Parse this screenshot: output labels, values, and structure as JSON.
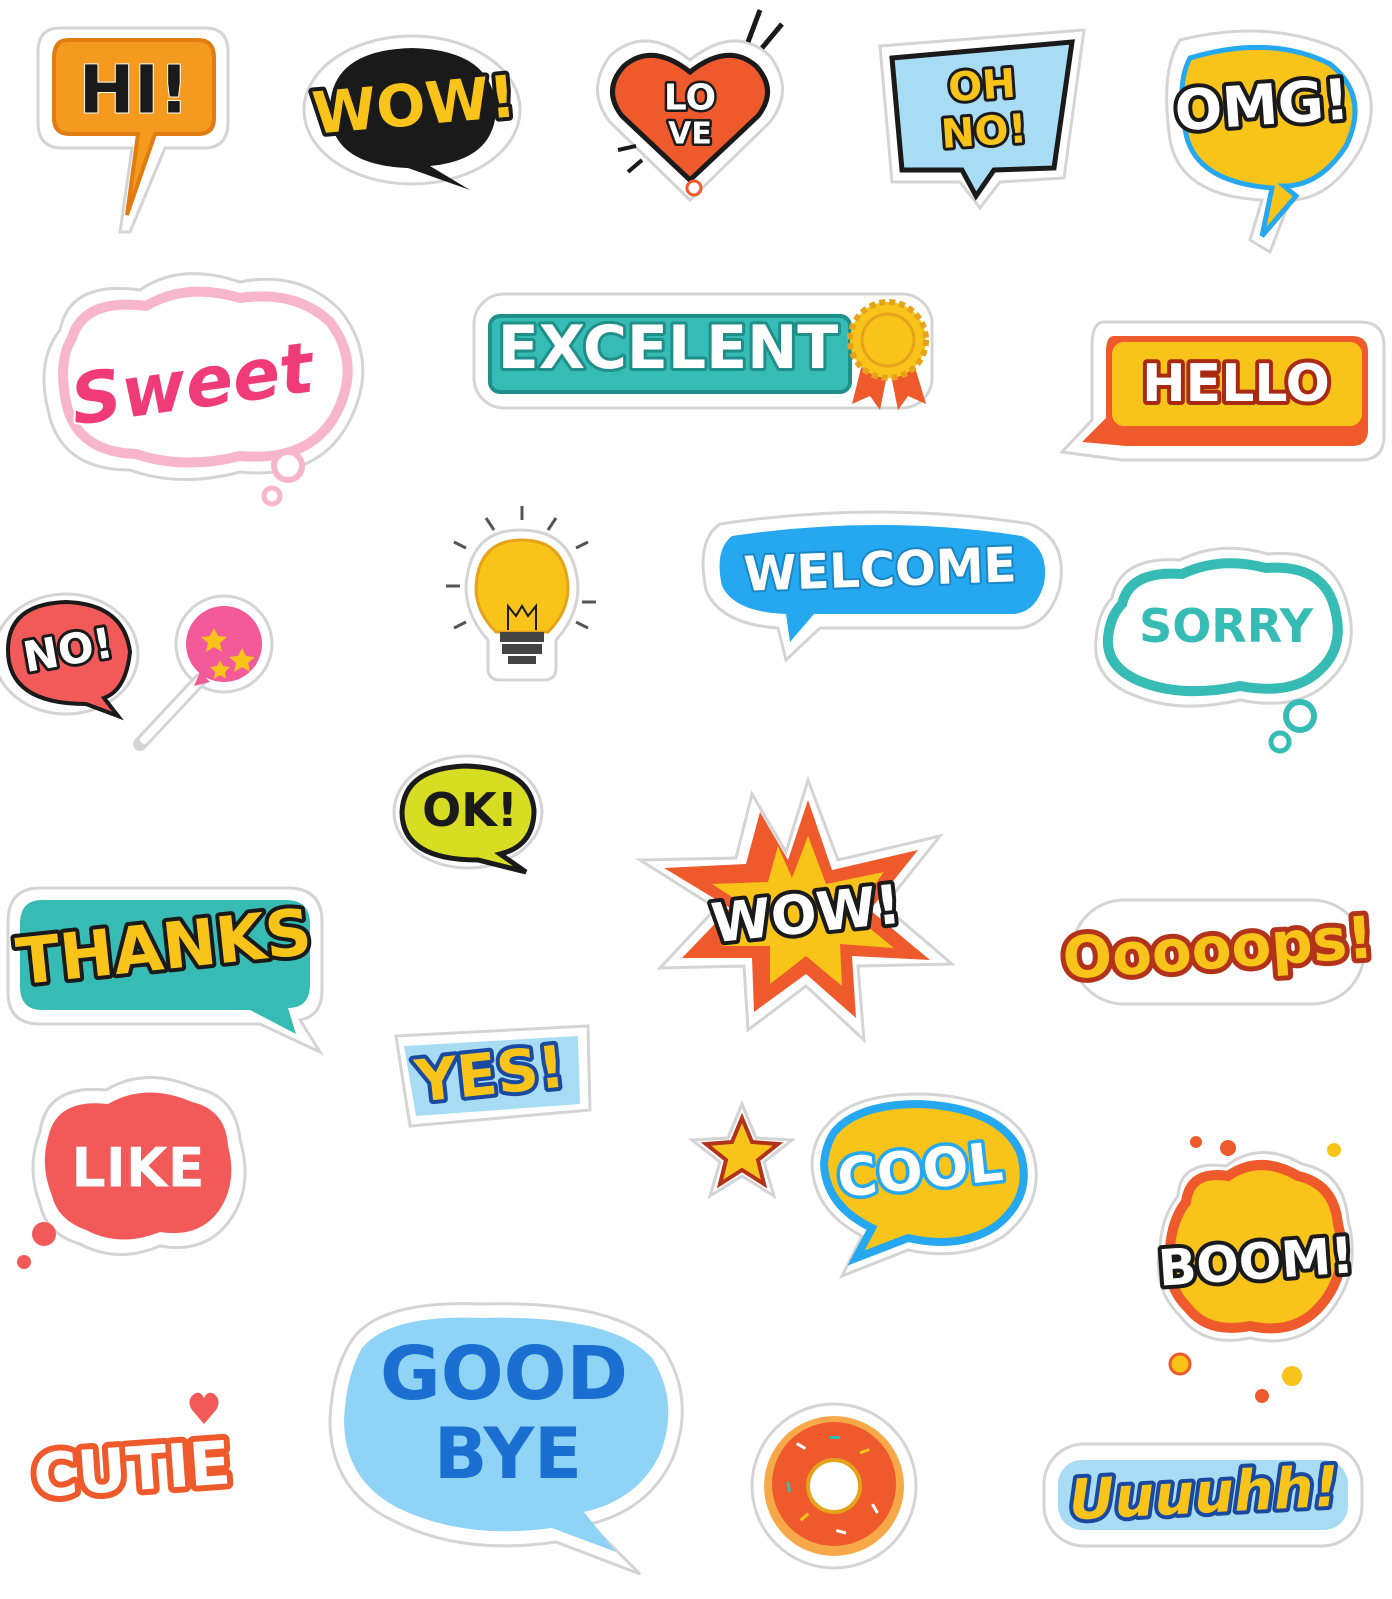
{
  "stickers": {
    "hi": "HI!",
    "wow_top": "WOW!",
    "love_1": "LO",
    "love_2": "VE",
    "ohno_1": "OH",
    "ohno_2": "NO!",
    "omg": "OMG!",
    "sweet": "Sweet",
    "excelent": "EXCELENT",
    "hello": "HELLO",
    "no": "NO!",
    "welcome": "WELCOME",
    "sorry": "SORRY",
    "ok": "OK!",
    "thanks": "THANKS",
    "wow_burst": "WOW!",
    "oooops": "Ooooops!",
    "yes": "YES!",
    "like": "LIKE",
    "cool": "COOL",
    "boom": "BOOM!",
    "goodbye_1": "GOOD",
    "goodbye_2": "BYE",
    "cutie": "CUTIE",
    "uuuuhh": "Uuuuhh!"
  },
  "colors": {
    "background": "#ffffff",
    "die_cut_border": "#d4d4d4",
    "yellow": "#f9c41a",
    "orange": "#f49a1e",
    "red_orange": "#ee5a2c",
    "black": "#1a1a1a",
    "teal": "#36bcb5",
    "sky_blue": "#25a8ef",
    "pink": "#ef3c78",
    "coral": "#f25a5a",
    "lime": "#d6dd23"
  },
  "icons": [
    "heart-icon",
    "award-ribbon-icon",
    "lightbulb-icon",
    "lollipop-icon",
    "star-icon",
    "donut-icon"
  ]
}
